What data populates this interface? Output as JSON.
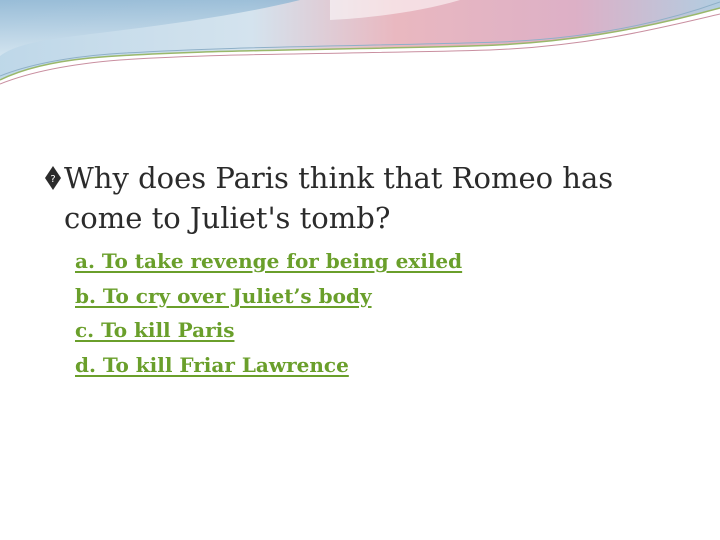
{
  "slide": {
    "question_line1": "Why does Paris think that Romeo has",
    "question_line2": "come to Juliet's tomb?",
    "answers": [
      "a. To take revenge for being exiled",
      "b. To cry over Juliet’s body",
      "c. To kill Paris",
      "d. To kill Friar Lawrence"
    ]
  },
  "colors": {
    "answer_link": "#6a9f2b",
    "question_text": "#2b2b2b",
    "banner_pink": "#e8a3ad",
    "banner_blue": "#9fc4dc",
    "banner_line": "#9ab86a"
  }
}
